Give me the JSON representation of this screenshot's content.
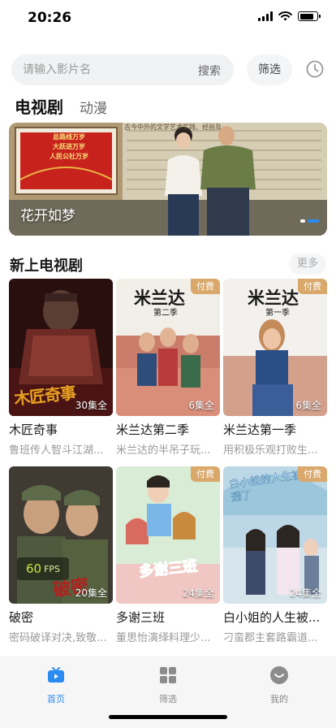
{
  "status_bar": {
    "time": "20:26"
  },
  "search": {
    "placeholder": "请输入影片名",
    "search_label": "搜索",
    "filter_label": "筛选"
  },
  "category_tabs": [
    {
      "label": "电视剧",
      "active": true
    },
    {
      "label": "动漫",
      "active": false
    }
  ],
  "banner": {
    "title": "花开如梦",
    "sign_text": [
      "总路线万岁",
      "大跃进万岁",
      "人民公社万岁"
    ],
    "background_caption": "古今中外的文学艺术实践、经验及"
  },
  "section": {
    "title": "新上电视剧",
    "more_label": "更多"
  },
  "shows": [
    {
      "title": "木匠奇事",
      "desc": "鲁班传人智斗江湖...",
      "episodes": "30集全",
      "paid": false,
      "poster_text": "木匠奇事"
    },
    {
      "title": "米兰达第二季",
      "desc": "米兰达的半吊子玩...",
      "episodes": "6集全",
      "paid": true,
      "poster_text": "米兰达",
      "poster_sub": "第二季"
    },
    {
      "title": "米兰达第一季",
      "desc": "用积极乐观打败生...",
      "episodes": "6集全",
      "paid": true,
      "poster_text": "米兰达",
      "poster_sub": "第一季"
    },
    {
      "title": "破密",
      "desc": "密码破译对决,致敬...",
      "episodes": "20集全",
      "paid": false,
      "poster_text": "破密",
      "fps_value": "60",
      "fps_label": "FPS"
    },
    {
      "title": "多谢三班",
      "desc": "董思怡演绎料理少...",
      "episodes": "24集全",
      "paid": true,
      "poster_text": "多谢三班"
    },
    {
      "title": "白小姐的人生被...",
      "desc": "刁蛮郡主套路霸道...",
      "episodes": "24集全",
      "paid": true,
      "poster_text": "白小姐的人生被剧透了"
    }
  ],
  "paid_label": "付费",
  "tab_bar": [
    {
      "label": "首页",
      "icon": "tv-icon",
      "active": true
    },
    {
      "label": "筛选",
      "icon": "grid-icon",
      "active": false
    },
    {
      "label": "我的",
      "icon": "smile-icon",
      "active": false
    }
  ],
  "colors": {
    "accent": "#2a8bf0",
    "paid_badge": "#d9a86a"
  }
}
